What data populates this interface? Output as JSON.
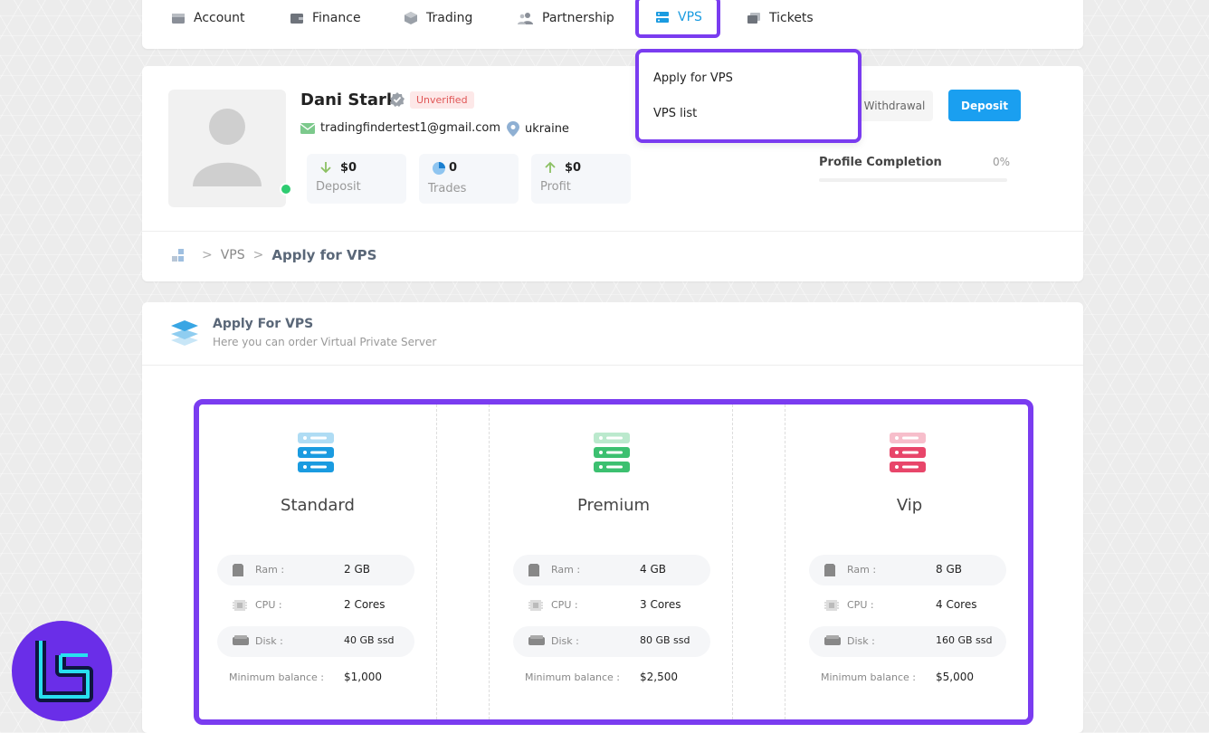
{
  "nav": {
    "items": [
      {
        "label": "Account",
        "icon": "account-icon"
      },
      {
        "label": "Finance",
        "icon": "wallet-icon"
      },
      {
        "label": "Trading",
        "icon": "cube-icon"
      },
      {
        "label": "Partnership",
        "icon": "users-icon"
      },
      {
        "label": "VPS",
        "icon": "server-icon",
        "active": true
      },
      {
        "label": "Tickets",
        "icon": "ticket-icon"
      }
    ]
  },
  "dropdown": {
    "items": [
      {
        "label": "Apply for VPS"
      },
      {
        "label": "VPS list"
      }
    ]
  },
  "profile": {
    "name": "Dani Stark",
    "status_badge": "Unverified",
    "email": "tradingfindertest1@gmail.com",
    "country": "ukraine",
    "stats": [
      {
        "value": "$0",
        "label": "Deposit"
      },
      {
        "value": "0",
        "label": "Trades"
      },
      {
        "value": "$0",
        "label": "Profit"
      }
    ],
    "withdrawal_label": "Withdrawal",
    "deposit_label": "Deposit",
    "completion_label": "Profile Completion",
    "completion_value": "0%",
    "completion_fraction": 0
  },
  "breadcrumb": {
    "items": [
      "VPS",
      "Apply for VPS"
    ]
  },
  "vps": {
    "title": "Apply For VPS",
    "subtitle": "Here you can order Virtual Private Server",
    "plans": [
      {
        "name": "Standard",
        "color": "#1a9be0",
        "ram_label": "Ram :",
        "ram": "2 GB",
        "cpu_label": "CPU :",
        "cpu": "2 Cores",
        "disk_label": "Disk :",
        "disk": "40 GB ssd",
        "min_balance_label": "Minimum balance :",
        "min_balance": "$1,000"
      },
      {
        "name": "Premium",
        "color": "#3cc070",
        "ram_label": "Ram :",
        "ram": "4 GB",
        "cpu_label": "CPU :",
        "cpu": "3 Cores",
        "disk_label": "Disk :",
        "disk": "80 GB ssd",
        "min_balance_label": "Minimum balance :",
        "min_balance": "$2,500"
      },
      {
        "name": "Vip",
        "color": "#e8466a",
        "ram_label": "Ram :",
        "ram": "8 GB",
        "cpu_label": "CPU :",
        "cpu": "4 Cores",
        "disk_label": "Disk :",
        "disk": "160 GB ssd",
        "min_balance_label": "Minimum balance :",
        "min_balance": "$5,000"
      }
    ]
  },
  "colors": {
    "accent_purple": "#7a3cf0",
    "primary_blue": "#1a9ff0",
    "unverified_red": "#e05656",
    "online_green": "#2ecc71"
  }
}
